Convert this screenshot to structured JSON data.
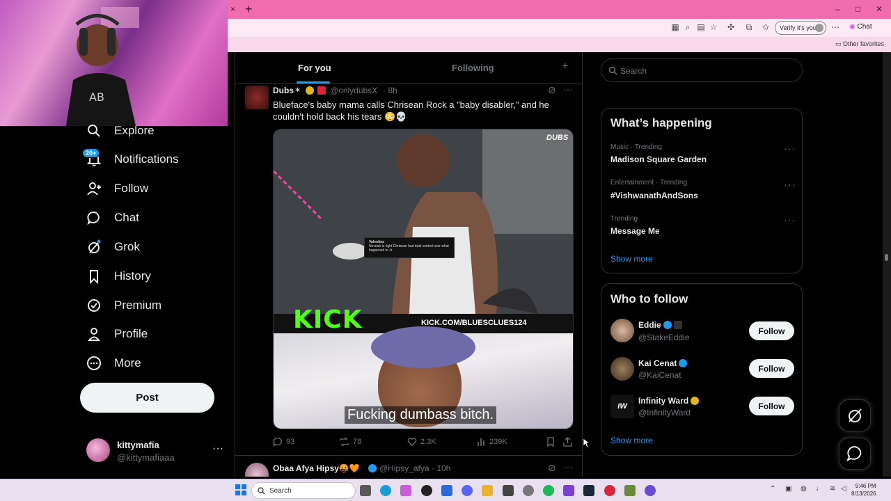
{
  "browser": {
    "new_tab": "+",
    "close_tab": "×",
    "verify_label": "Verify it's you",
    "chat_label": "Chat",
    "other_favorites": "Other favorites",
    "window_controls": [
      "–",
      "□",
      "✕"
    ]
  },
  "sidebar": {
    "notifications_badge": "20+",
    "items": [
      {
        "label": "Explore",
        "icon": "search-icon"
      },
      {
        "label": "Notifications",
        "icon": "bell-icon"
      },
      {
        "label": "Follow",
        "icon": "person-add-icon"
      },
      {
        "label": "Chat",
        "icon": "chat-bubble-icon"
      },
      {
        "label": "Grok",
        "icon": "grok-icon"
      },
      {
        "label": "History",
        "icon": "bookmark-icon"
      },
      {
        "label": "Premium",
        "icon": "verified-badge-icon"
      },
      {
        "label": "Profile",
        "icon": "person-icon"
      },
      {
        "label": "More",
        "icon": "more-circle-icon"
      }
    ],
    "post_button": "Post",
    "account": {
      "name": "kittymafia",
      "handle": "@kittymafiaaa",
      "menu": "···"
    }
  },
  "feed": {
    "tabs": [
      {
        "label": "For you",
        "active": true
      },
      {
        "label": "Following",
        "active": false
      }
    ],
    "add_tab": "+",
    "tweet": {
      "author": "Dubs",
      "handle": "@onlydubsX",
      "time": "· 8h",
      "text": "Blueface's baby mama calls Chrisean Rock a \"baby disabler,\" and he couldn't hold back his tears 😳💀",
      "media": {
        "watermark": "DUBS",
        "overlay_name": "Valentina",
        "overlay_comment": "Neveah is right Chrisean had total control over what happened to Jr",
        "kick_logo": "KICK",
        "kick_url": "KICK.COM/BLUESCLUES124",
        "subtitle": "Fucking dumbass bitch."
      },
      "stats": {
        "replies": "93",
        "reposts": "78",
        "likes": "2.3K",
        "views": "239K"
      }
    },
    "next_tweet": {
      "author": "Obaa Afya Hipsy🤬🧡",
      "handle": "@Hipsy_afya",
      "time": "· 10h"
    }
  },
  "right": {
    "search_placeholder": "Search",
    "whats_happening": {
      "title": "What’s happening",
      "trends": [
        {
          "category": "Music · Trending",
          "name": "Madison Square Garden"
        },
        {
          "category": "Entertainment · Trending",
          "name": "#VishwanathAndSons"
        },
        {
          "category": "Trending",
          "name": "Message Me"
        }
      ],
      "show_more": "Show more"
    },
    "who_to_follow": {
      "title": "Who to follow",
      "accounts": [
        {
          "name": "Eddie",
          "handle": "@StakeEddie",
          "button": "Follow"
        },
        {
          "name": "Kai Cenat",
          "handle": "@KaiCenat",
          "button": "Follow"
        },
        {
          "name": "Infinity Ward",
          "handle": "@InfinityWard",
          "button": "Follow"
        }
      ],
      "show_more": "Show more"
    }
  },
  "taskbar": {
    "search_label": "Search",
    "time": "9:46 PM",
    "date": "8/13/2026"
  },
  "colors": {
    "accent": "#1d9bf0",
    "browser_tab": "#f06cac",
    "background": "#000000"
  }
}
